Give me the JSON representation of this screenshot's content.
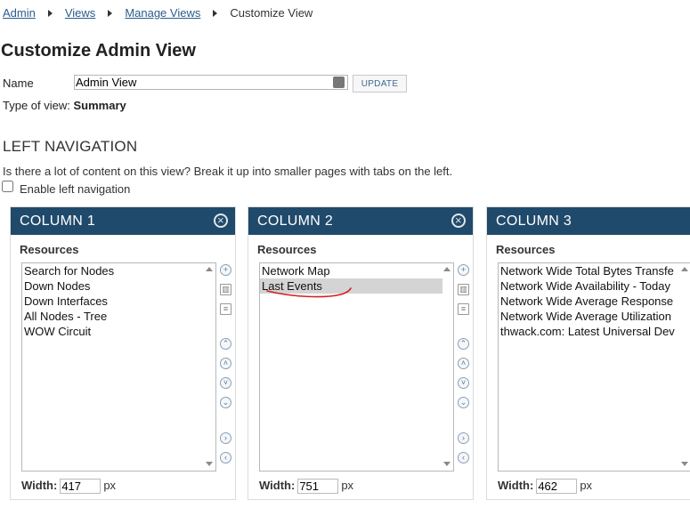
{
  "breadcrumb": {
    "items": [
      "Admin",
      "Views",
      "Manage Views"
    ],
    "current": "Customize View"
  },
  "page_title": "Customize Admin View",
  "name_field": {
    "label": "Name",
    "value": "Admin View",
    "button": "UPDATE"
  },
  "type_of_view": {
    "label": "Type of view:",
    "value": "Summary"
  },
  "left_nav": {
    "heading": "LEFT NAVIGATION",
    "description": "Is there a lot of content on this view? Break it up into smaller pages with tabs on the left.",
    "checkbox_label": "Enable left navigation",
    "checked": false
  },
  "columns": [
    {
      "title": "COLUMN 1",
      "resources_label": "Resources",
      "items": [
        "Search for Nodes",
        "Down Nodes",
        "Down Interfaces",
        "All Nodes - Tree",
        "WOW Circuit"
      ],
      "selected_index": -1,
      "width_label": "Width:",
      "width": "417",
      "unit": "px"
    },
    {
      "title": "COLUMN 2",
      "resources_label": "Resources",
      "items": [
        "Network Map",
        "Last Events"
      ],
      "selected_index": 1,
      "width_label": "Width:",
      "width": "751",
      "unit": "px"
    },
    {
      "title": "COLUMN 3",
      "resources_label": "Resources",
      "items": [
        "Network Wide Total Bytes Transfe",
        "Network Wide Availability - Today",
        "Network Wide Average Response",
        "Network Wide Average Utilization",
        "thwack.com: Latest Universal Dev"
      ],
      "selected_index": -1,
      "width_label": "Width:",
      "width": "462",
      "unit": "px"
    }
  ],
  "tool_icons": [
    "add-icon",
    "delete-icon",
    "copy-icon",
    "move-top-icon",
    "move-up-icon",
    "move-down-icon",
    "move-bottom-icon",
    "move-right-icon",
    "move-left-icon"
  ],
  "colors": {
    "column_header": "#204a6b",
    "link": "#2a5d8c",
    "annotation": "#d42020"
  }
}
